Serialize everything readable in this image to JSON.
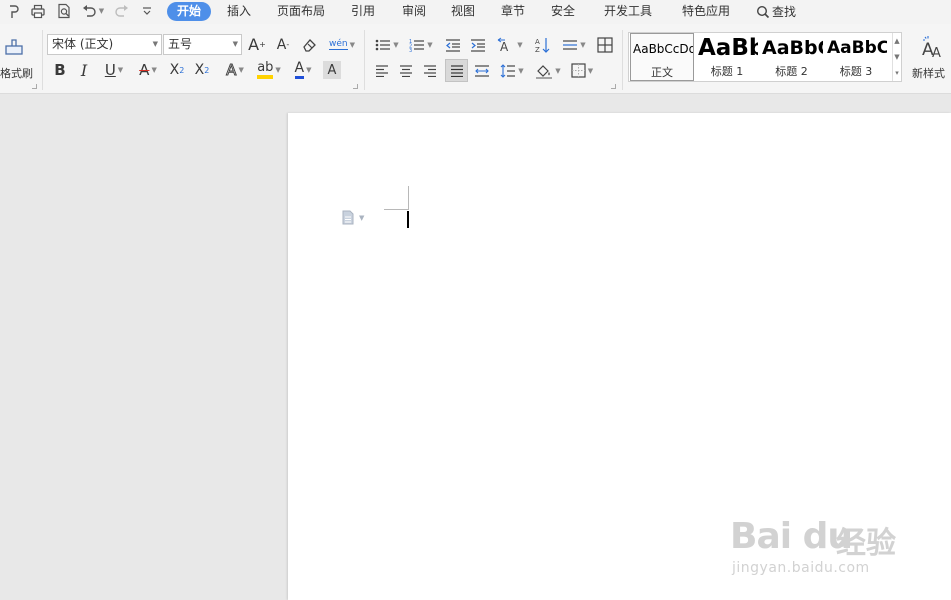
{
  "quick_access": {
    "icons": [
      "format-painter-icon",
      "print-icon",
      "print-preview-icon",
      "undo-icon",
      "redo-icon",
      "customize-icon"
    ]
  },
  "menu_tabs": [
    {
      "label": "开始",
      "active": true
    },
    {
      "label": "插入",
      "active": false
    },
    {
      "label": "页面布局",
      "active": false
    },
    {
      "label": "引用",
      "active": false
    },
    {
      "label": "审阅",
      "active": false
    },
    {
      "label": "视图",
      "active": false
    },
    {
      "label": "章节",
      "active": false
    },
    {
      "label": "安全",
      "active": false
    },
    {
      "label": "开发工具",
      "active": false
    },
    {
      "label": "特色应用",
      "active": false
    }
  ],
  "search": {
    "label": "查找"
  },
  "clipboard": {
    "format_painter_label": "格式刷"
  },
  "font": {
    "family": "宋体 (正文)",
    "size": "五号",
    "bold_label": "B",
    "italic_label": "I",
    "underline_label": "U",
    "strike_label": "A",
    "superscript_label": "X",
    "subscript_label": "X",
    "effects_label": "A",
    "highlight_label": "ab",
    "font_color_label": "A",
    "char_shading_label": "A",
    "grow_label": "A",
    "shrink_label": "A",
    "phonetic_label": "wén"
  },
  "styles": {
    "items": [
      {
        "sample": "AaBbCcDd",
        "name": "正文"
      },
      {
        "sample": "AaBb",
        "name": "标题 1"
      },
      {
        "sample": "AaBbC",
        "name": "标题 2"
      },
      {
        "sample": "AaBbCc",
        "name": "标题 3"
      }
    ],
    "new_style_label": "新样式"
  },
  "colors": {
    "accent": "#4e8fe9",
    "highlight": "#ffd200",
    "font_color": "#1f4fd8",
    "strike_color": "#d93025"
  },
  "watermark": {
    "logo": "Bai du",
    "word": "经验",
    "url": "jingyan.baidu.com"
  }
}
